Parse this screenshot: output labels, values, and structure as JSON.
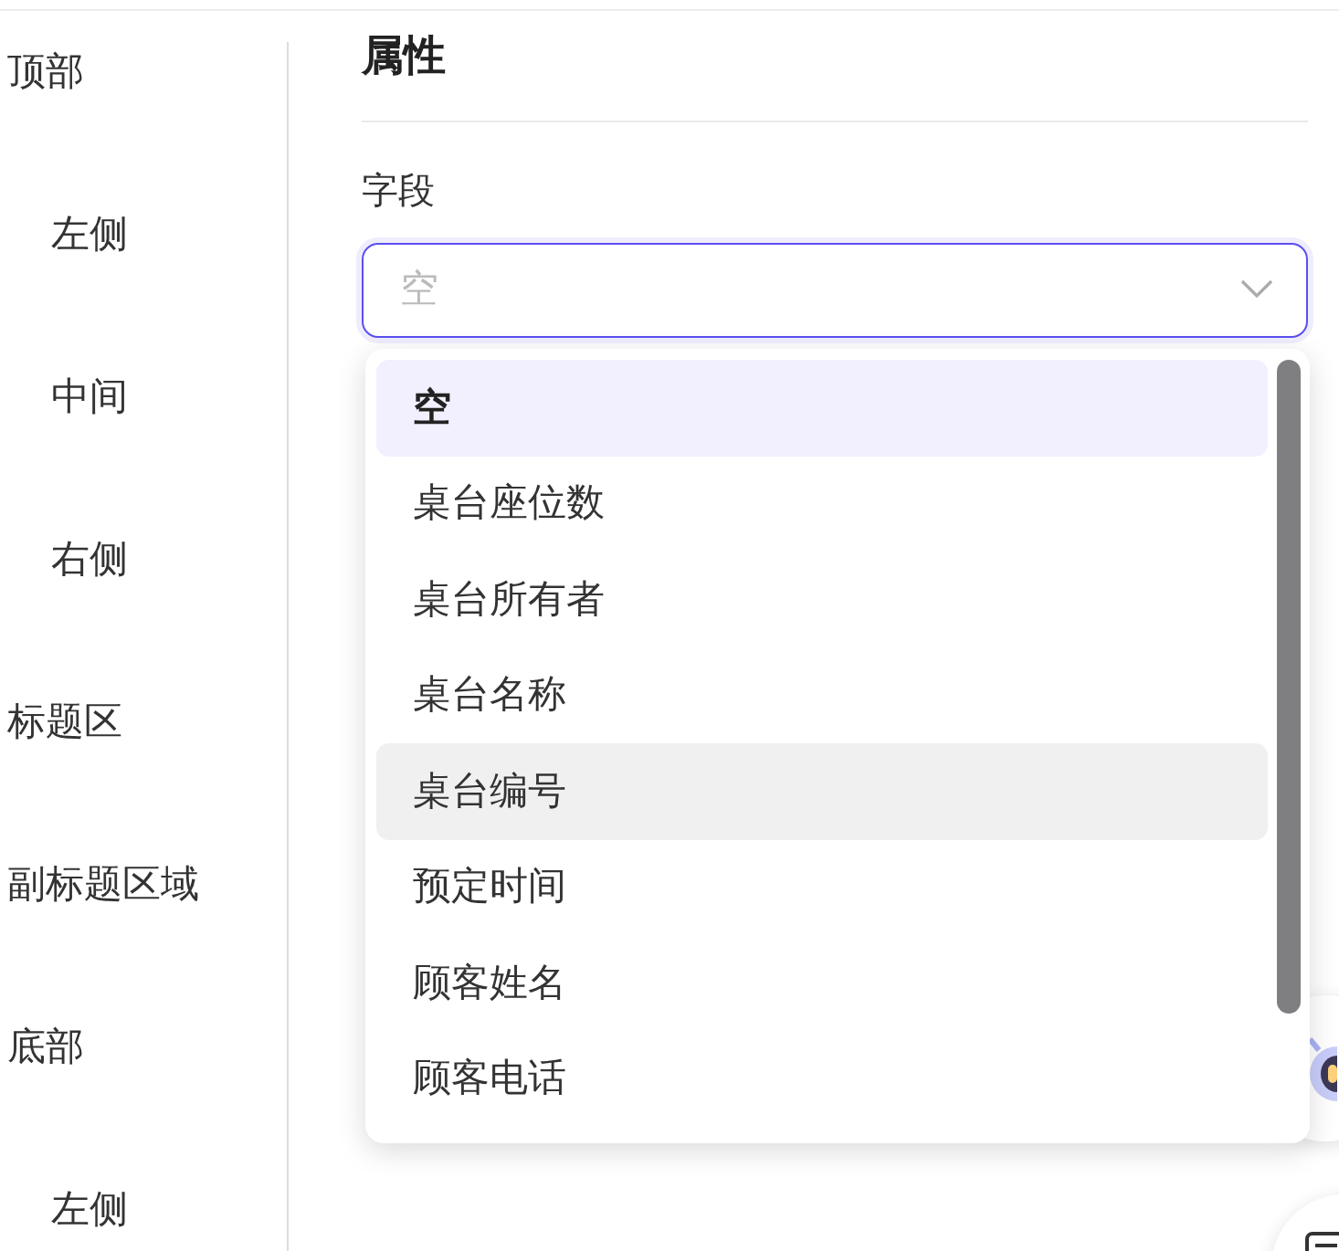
{
  "sidebar": {
    "items": [
      {
        "label": "顶部",
        "children": [
          {
            "label": "左侧"
          },
          {
            "label": "中间"
          },
          {
            "label": "右侧"
          }
        ]
      },
      {
        "label": "标题区"
      },
      {
        "label": "副标题区域"
      },
      {
        "label": "底部",
        "children": [
          {
            "label": "左侧"
          }
        ]
      }
    ]
  },
  "panel": {
    "title": "属性",
    "field": {
      "label": "字段",
      "placeholder": "空",
      "options": [
        {
          "label": "空",
          "selected": true,
          "highlighted": false
        },
        {
          "label": "桌台座位数",
          "selected": false,
          "highlighted": false
        },
        {
          "label": "桌台所有者",
          "selected": false,
          "highlighted": false
        },
        {
          "label": "桌台名称",
          "selected": false,
          "highlighted": false
        },
        {
          "label": "桌台编号",
          "selected": false,
          "highlighted": true
        },
        {
          "label": "预定时间",
          "selected": false,
          "highlighted": false
        },
        {
          "label": "顾客姓名",
          "selected": false,
          "highlighted": false
        },
        {
          "label": "顾客电话",
          "selected": false,
          "highlighted": false
        }
      ]
    }
  }
}
